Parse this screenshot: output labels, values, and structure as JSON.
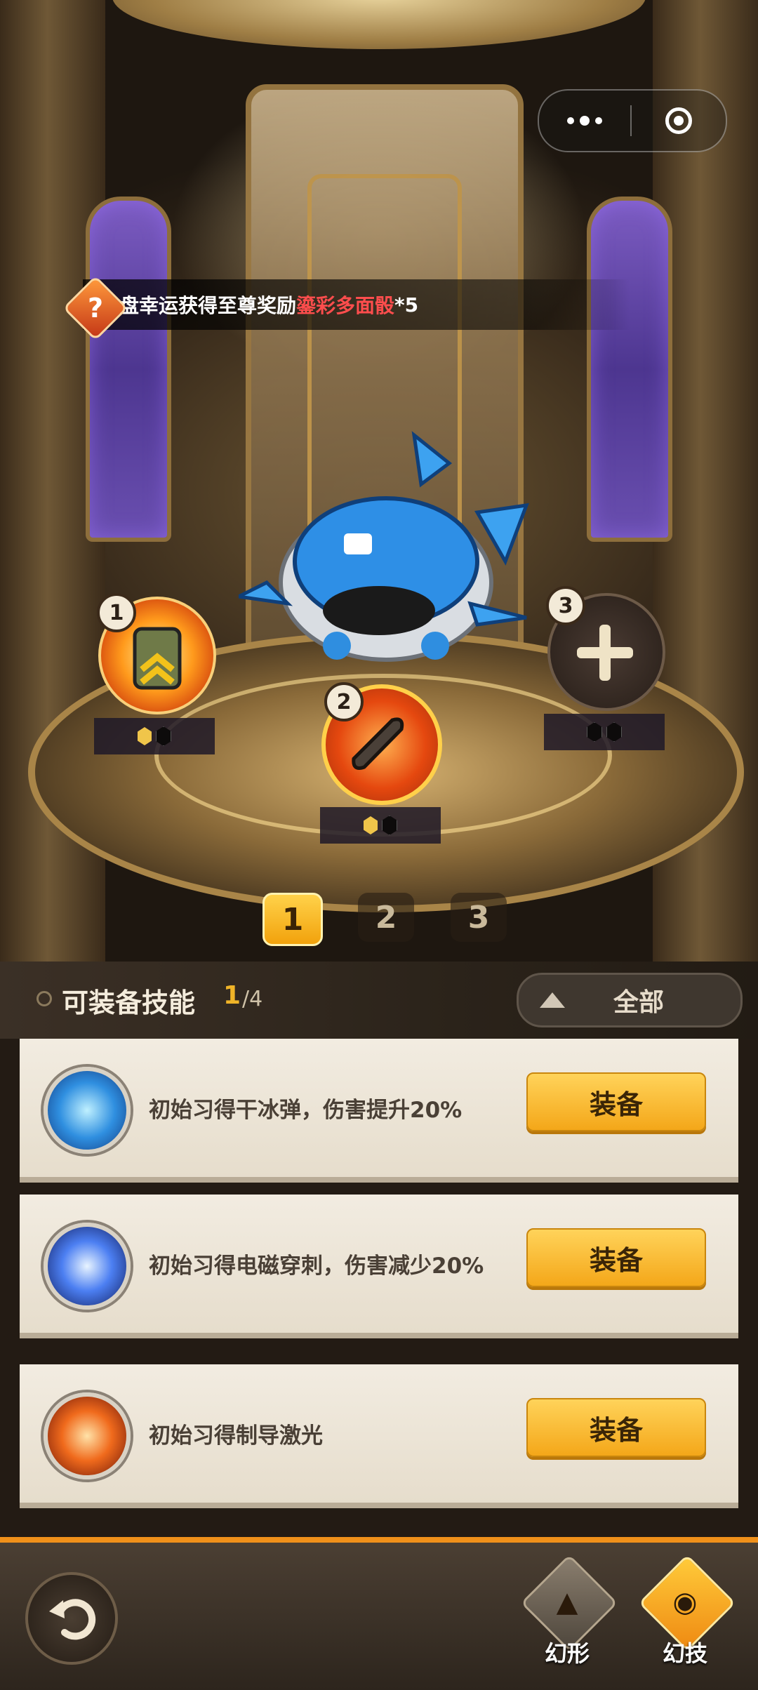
{
  "top_bar": {
    "more_icon": "more-dots-icon",
    "close_icon": "target-icon"
  },
  "notice": {
    "prefix": "盘幸运获得至尊奖励",
    "highlight": "鎏彩多面骰",
    "suffix": "*5"
  },
  "slots": [
    {
      "number": "1",
      "gems": [
        "gold",
        "dark"
      ],
      "icon": "backpack-upgrade-icon"
    },
    {
      "number": "2",
      "gems": [
        "gold",
        "dark"
      ],
      "icon": "fire-bullet-icon"
    },
    {
      "number": "3",
      "gems": [
        "dark",
        "dark"
      ],
      "icon": "plus-icon"
    }
  ],
  "pages": [
    "1",
    "2",
    "3"
  ],
  "active_page": "1",
  "panel": {
    "title": "可装备技能",
    "count": "1",
    "total": "/4",
    "filter_label": "全部"
  },
  "skills": [
    {
      "description": "初始习得干冰弹，伤害提升20%",
      "button": "装备",
      "icon": "ice-missile-icon"
    },
    {
      "description": "初始习得电磁穿刺，伤害减少20%",
      "button": "装备",
      "icon": "lightning-pierce-icon"
    },
    {
      "description": "初始习得制导激光",
      "button": "装备",
      "icon": "guided-laser-icon"
    }
  ],
  "bottom_nav": {
    "form_label": "幻形",
    "skill_label": "幻技"
  },
  "colors": {
    "accent": "#f4a719",
    "highlight_red": "#ff4d4d",
    "bottom_border": "#f0901a"
  }
}
